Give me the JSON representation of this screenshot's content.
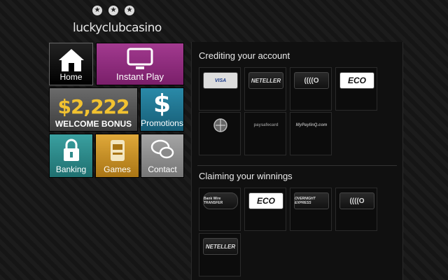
{
  "logo": {
    "text": "luckyclubcasino",
    "stars": [
      "★",
      "★",
      "★"
    ]
  },
  "nav": {
    "home": "Home",
    "instant_play": "Instant Play",
    "bonus_amount": "$2,222",
    "bonus_text": "WELCOME BONUS",
    "promotions": "Promotions",
    "banking": "Banking",
    "games": "Games",
    "contact": "Contact"
  },
  "crediting": {
    "title": "Crediting your account",
    "methods": [
      {
        "name": "credit-cards",
        "label": "VISA"
      },
      {
        "name": "neteller",
        "label": "NETELLER"
      },
      {
        "name": "ukash",
        "label": "((((O"
      },
      {
        "name": "ecocard",
        "label": "ECO"
      },
      {
        "name": "globe-payment",
        "label": ""
      },
      {
        "name": "paysafecard",
        "label": "paysafecard"
      },
      {
        "name": "mypaylinq",
        "label": "MyPaylinQ.com"
      }
    ]
  },
  "claiming": {
    "title": "Claiming your winnings",
    "methods": [
      {
        "name": "bank-wire",
        "label": "Bank Wire TRANSFER"
      },
      {
        "name": "ecocard",
        "label": "ECO"
      },
      {
        "name": "overnight-express",
        "label": "OVERNIGHT EXPRESS"
      },
      {
        "name": "ukash",
        "label": "((((O"
      },
      {
        "name": "neteller",
        "label": "NETELLER"
      }
    ]
  },
  "colors": {
    "instant_play": "#8e2a7c",
    "promotions": "#1f6f8b",
    "banking": "#2f8a8a",
    "games": "#c99324",
    "contact": "#909090"
  }
}
